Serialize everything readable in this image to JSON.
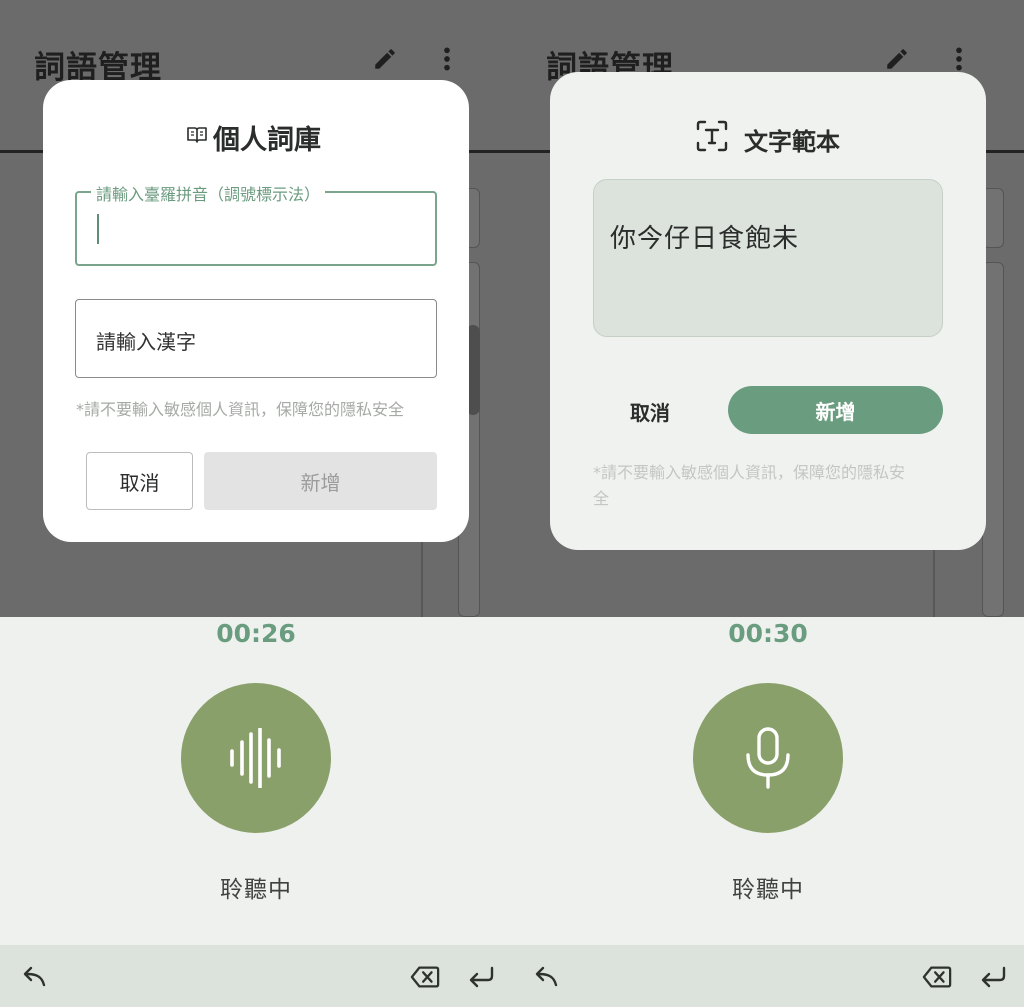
{
  "left": {
    "app": {
      "title": "詞語管理"
    },
    "dialog": {
      "title": "個人詞庫",
      "field1_label": "請輸入臺羅拼音（調號標示法）",
      "field2_placeholder": "請輸入漢字",
      "note": "*請不要輸入敏感個人資訊，保障您的隱私安全",
      "cancel_label": "取消",
      "add_label": "新增"
    },
    "recorder": {
      "timer": "00:26",
      "status": "聆聽中",
      "icon": "sound-wave-icon"
    }
  },
  "right": {
    "app": {
      "title": "詞語管理"
    },
    "dialog": {
      "title": "文字範本",
      "sample_text": "你今仔日食飽未",
      "cancel_label": "取消",
      "add_label": "新增",
      "note_line1": "*請不要輸入敏感個人資訊，保障您的隱私安",
      "note_line2": "全"
    },
    "recorder": {
      "timer": "00:30",
      "status": "聆聽中",
      "icon": "microphone-icon"
    }
  },
  "colors": {
    "accent": "#6a9d7f",
    "button_green": "#6a9d7f",
    "record_circle": "#8aa06a",
    "scrim": "#6b6b6b",
    "bottom_bar": "#dce3dc"
  }
}
